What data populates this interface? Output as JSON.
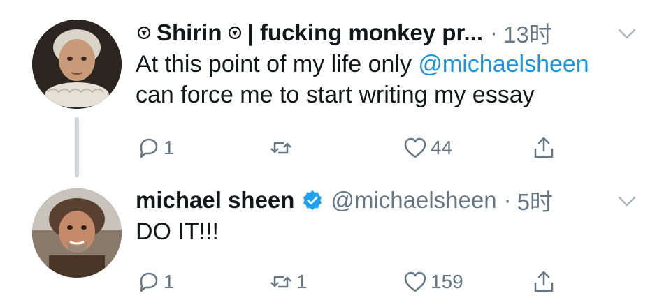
{
  "tweets": [
    {
      "name": "Shirin",
      "name_suffix": "| fucking monkey pr...",
      "time": "13时",
      "body_parts": [
        "At this point of my life only ",
        "@michaelsheen",
        "\ncan force me to start writing my essay"
      ],
      "replies": "1",
      "retweets": "",
      "likes": "44"
    },
    {
      "name": "michael sheen",
      "handle": "@michaelsheen",
      "time": "5时",
      "body": "DO IT!!!",
      "replies": "1",
      "retweets": "1",
      "likes": "159"
    }
  ],
  "separator": "·",
  "colors": {
    "link": "#1b95e0",
    "verified": "#1da1f2",
    "secondary": "#657786",
    "thread_line": "#ccd6dd"
  },
  "icons": [
    "reply-icon",
    "retweet-icon",
    "like-icon",
    "share-icon",
    "chevron-down-icon",
    "verified-badge-icon",
    "play-circle-emoji-icon"
  ]
}
